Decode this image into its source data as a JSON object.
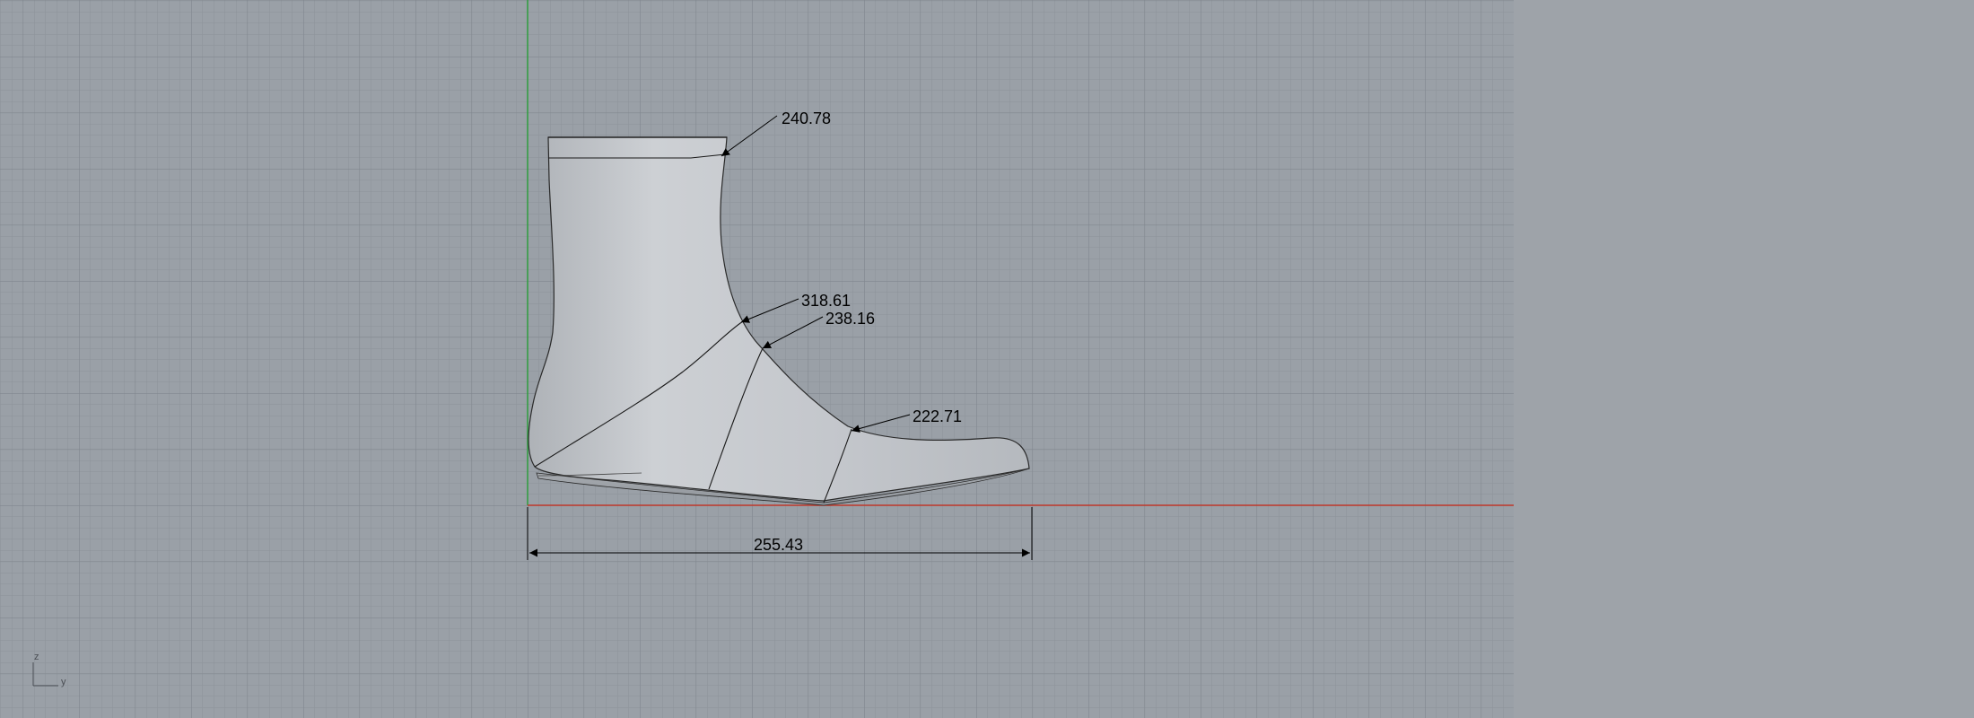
{
  "viewport": {
    "name": "Right",
    "background": "#9aa0a7",
    "grid_minor_color": "#8c929a",
    "grid_major_color": "#7e848c",
    "x_axis_color": "#c0392b",
    "y_axis_color": "#2e9e3e"
  },
  "model": {
    "object": "boot-last",
    "fill": "#c9ccd0",
    "edge": "#1a1a1a"
  },
  "dimensions": {
    "top_opening": "240.78",
    "instep": "318.61",
    "ankle_girth": "238.16",
    "ball_girth": "222.71",
    "length": "255.43"
  },
  "axis_icon": {
    "vertical_label": "z",
    "horizontal_label": "y"
  }
}
